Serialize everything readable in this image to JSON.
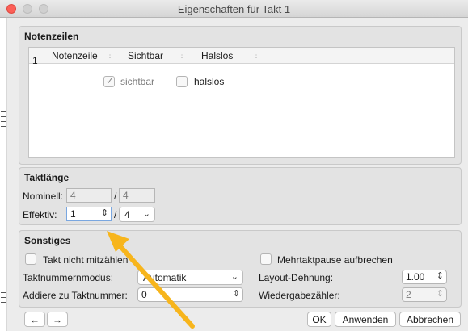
{
  "window": {
    "title": "Eigenschaften für Takt 1"
  },
  "notenzeilen": {
    "title": "Notenzeilen",
    "columns": [
      "Notenzeile",
      "Sichtbar",
      "Halslos"
    ],
    "rows": [
      {
        "notenzeile": "1",
        "sichtbar_label": "sichtbar",
        "sichtbar_checked": true,
        "halslos_label": "halslos",
        "halslos_checked": false
      }
    ]
  },
  "taktlaenge": {
    "title": "Taktlänge",
    "nominell_label": "Nominell:",
    "nominell_num": "4",
    "nominell_slash": "/",
    "nominell_den": "4",
    "effektiv_label": "Effektiv:",
    "effektiv_num": "1",
    "effektiv_slash": "/",
    "effektiv_den": "4"
  },
  "sonstiges": {
    "title": "Sonstiges",
    "takt_nicht_mitzaehlen": "Takt nicht mitzählen",
    "mehrtaktpause": "Mehrtaktpause aufbrechen",
    "taktnummernmodus_label": "Taktnummernmodus:",
    "taktnummernmodus_value": "Automatik",
    "layout_dehnung_label": "Layout-Dehnung:",
    "layout_dehnung_value": "1.00",
    "addiere_label": "Addiere zu Taktnummer:",
    "addiere_value": "0",
    "wiedergabe_label": "Wiedergabezähler:",
    "wiedergabe_value": "2"
  },
  "buttons": {
    "prev": "←",
    "next": "→",
    "ok": "OK",
    "anwenden": "Anwenden",
    "abbrechen": "Abbrechen"
  },
  "colors": {
    "annotation_arrow": "#f7b51c",
    "close": "#fc5f57"
  }
}
